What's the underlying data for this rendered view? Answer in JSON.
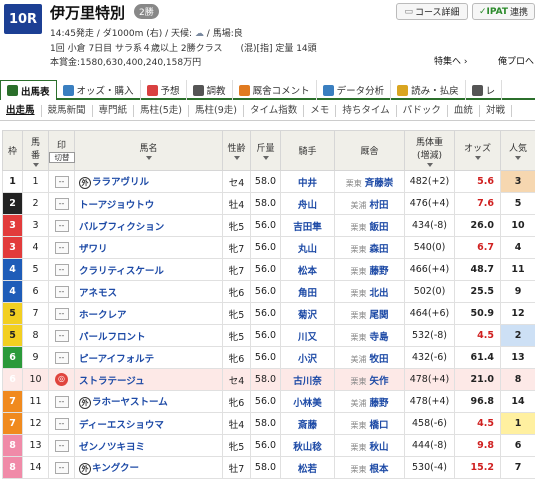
{
  "race": {
    "number": "10R",
    "name": "伊万里特別",
    "grade": "2勝",
    "line1": "14:45発走 / ダ1000m (右) / 天候:",
    "line1_tail": "/ 馬場:良",
    "line2": "1回 小倉 7日目 サラ系４歳以上 2勝クラス　　(混)[指] 定量 14頭",
    "line3": "本賞金:1580,630,400,240,158万円"
  },
  "header_buttons": {
    "course": "コース詳細",
    "ipat": "IPAT",
    "ipat_prefix": "✓",
    "ipat_tail": "連携"
  },
  "header_links": {
    "tokusyu": "特集へ ›",
    "ore": "俺プロへ"
  },
  "tabs": [
    {
      "label": "出馬表",
      "color": "#2b6f2b"
    },
    {
      "label": "オッズ・購入",
      "color": "#3a7fc0"
    },
    {
      "label": "予想",
      "color": "#d94040"
    },
    {
      "label": "調教",
      "color": "#555"
    },
    {
      "label": "厩舎コメント",
      "color": "#e07a20"
    },
    {
      "label": "データ分析",
      "color": "#3a7fc0"
    },
    {
      "label": "読み・払戻",
      "color": "#d9a520"
    },
    {
      "label": "レ",
      "color": "#555"
    }
  ],
  "subtabs": [
    "出走馬",
    "競馬新聞",
    "専門紙",
    "馬柱(5走)",
    "馬柱(9走)",
    "タイム指数",
    "メモ",
    "持ちタイム",
    "パドック",
    "血統",
    "対戦"
  ],
  "columns": {
    "waku": "枠",
    "umaban1": "馬",
    "umaban2": "番",
    "mark": "印",
    "mark_sub": "切替",
    "name": "馬名",
    "sex": "性齢",
    "weight": "斤量",
    "jockey": "騎手",
    "trainer": "厩舎",
    "bw1": "馬体重",
    "bw2": "(増減)",
    "odds": "オッズ",
    "pop1": "人気"
  },
  "horses": [
    {
      "waku": "1",
      "num": "1",
      "badge": "外",
      "name": "ララアヴリル",
      "sex": "セ4",
      "kin": "58.0",
      "jockey": "中井",
      "area": "栗東",
      "trainer": "斉藤崇",
      "bw": "482(+2)",
      "odds": "5.6",
      "pop": "3",
      "red": true
    },
    {
      "waku": "2",
      "num": "2",
      "badge": "",
      "name": "トーアジョウトウ",
      "sex": "牡4",
      "kin": "58.0",
      "jockey": "舟山",
      "area": "美浦",
      "trainer": "村田",
      "bw": "476(+4)",
      "odds": "7.6",
      "pop": "5",
      "red": true
    },
    {
      "waku": "3",
      "num": "3",
      "badge": "",
      "name": "バルブフィクション",
      "sex": "牝5",
      "kin": "56.0",
      "jockey": "吉田隼",
      "area": "栗東",
      "trainer": "飯田",
      "bw": "434(-8)",
      "odds": "26.0",
      "pop": "10",
      "red": false
    },
    {
      "waku": "3",
      "num": "4",
      "badge": "",
      "name": "ザワリ",
      "sex": "牝7",
      "kin": "56.0",
      "jockey": "丸山",
      "area": "栗東",
      "trainer": "森田",
      "bw": "540(0)",
      "odds": "6.7",
      "pop": "4",
      "red": true
    },
    {
      "waku": "4",
      "num": "5",
      "badge": "",
      "name": "クラリティスケール",
      "sex": "牝7",
      "kin": "56.0",
      "jockey": "松本",
      "area": "栗東",
      "trainer": "藤野",
      "bw": "466(+4)",
      "odds": "48.7",
      "pop": "11",
      "red": false
    },
    {
      "waku": "4",
      "num": "6",
      "badge": "",
      "name": "アネモス",
      "sex": "牝6",
      "kin": "56.0",
      "jockey": "角田",
      "area": "栗東",
      "trainer": "北出",
      "bw": "502(0)",
      "odds": "25.5",
      "pop": "9",
      "red": false
    },
    {
      "waku": "5",
      "num": "7",
      "badge": "",
      "name": "ホークレア",
      "sex": "牝5",
      "kin": "56.0",
      "jockey": "菊沢",
      "area": "栗東",
      "trainer": "尾関",
      "bw": "464(+6)",
      "odds": "50.9",
      "pop": "12",
      "red": false
    },
    {
      "waku": "5",
      "num": "8",
      "badge": "",
      "name": "パールフロント",
      "sex": "牝5",
      "kin": "56.0",
      "jockey": "川又",
      "area": "栗東",
      "trainer": "寺島",
      "bw": "532(-8)",
      "odds": "4.5",
      "pop": "2",
      "red": true
    },
    {
      "waku": "6",
      "num": "9",
      "badge": "",
      "name": "ピーアイフォルテ",
      "sex": "牝6",
      "kin": "56.0",
      "jockey": "小沢",
      "area": "美浦",
      "trainer": "牧田",
      "bw": "432(-6)",
      "odds": "61.4",
      "pop": "13",
      "red": false
    },
    {
      "waku": "6",
      "num": "10",
      "badge": "",
      "name": "ストラテージュ",
      "sex": "セ4",
      "kin": "58.0",
      "jockey": "古川奈",
      "area": "栗東",
      "trainer": "矢作",
      "bw": "478(+4)",
      "odds": "21.0",
      "pop": "8",
      "red": false,
      "hl": true
    },
    {
      "waku": "7",
      "num": "11",
      "badge": "外",
      "name": "ラホーヤストーム",
      "sex": "牝6",
      "kin": "56.0",
      "jockey": "小林美",
      "area": "美浦",
      "trainer": "藤野",
      "bw": "478(+4)",
      "odds": "96.8",
      "pop": "14",
      "red": false
    },
    {
      "waku": "7",
      "num": "12",
      "badge": "",
      "name": "ディーエスショウマ",
      "sex": "牡4",
      "kin": "58.0",
      "jockey": "斎藤",
      "area": "栗東",
      "trainer": "橋口",
      "bw": "458(-6)",
      "odds": "4.5",
      "pop": "1",
      "red": true
    },
    {
      "waku": "8",
      "num": "13",
      "badge": "",
      "name": "ゼンノツキヨミ",
      "sex": "牝5",
      "kin": "56.0",
      "jockey": "秋山稔",
      "area": "栗東",
      "trainer": "秋山",
      "bw": "444(-8)",
      "odds": "9.8",
      "pop": "6",
      "red": true
    },
    {
      "waku": "8",
      "num": "14",
      "badge": "外",
      "name": "キングクー",
      "sex": "牡7",
      "kin": "58.0",
      "jockey": "松若",
      "area": "栗東",
      "trainer": "根本",
      "bw": "530(-4)",
      "odds": "15.2",
      "pop": "7",
      "red": true
    }
  ]
}
